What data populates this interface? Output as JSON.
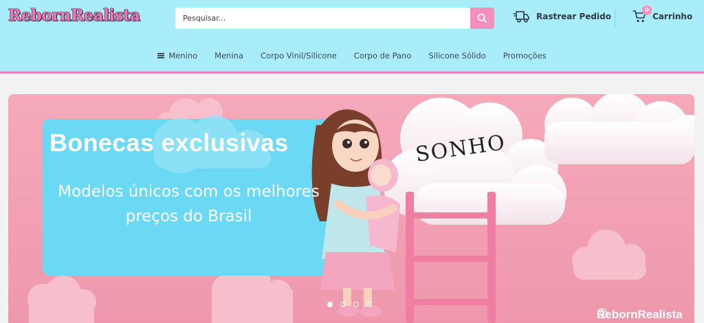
{
  "brand": {
    "logo_text": "RebornRealista"
  },
  "search": {
    "placeholder": "Pesquisar..."
  },
  "header": {
    "track_order_label": "Rastrear Pedido",
    "cart_label": "Carrinho",
    "cart_count": "0"
  },
  "nav": {
    "items": [
      {
        "label": "Menino"
      },
      {
        "label": "Menina"
      },
      {
        "label": "Corpo Vinil/Silicone"
      },
      {
        "label": "Corpo de Pano"
      },
      {
        "label": "Silicone Sólido"
      },
      {
        "label": "Promoções"
      }
    ]
  },
  "hero": {
    "headline": "Bonecas exclusivas",
    "subhead": "Modelos únicos com os melhores preços do Brasil",
    "cloud_text": "SONHO",
    "watermark": "RebornRealista",
    "slides": {
      "count": 4,
      "active": 1
    }
  },
  "colors": {
    "header_bg": "#a9ecfa",
    "accent_pink": "#f48ebd",
    "banner_pink": "#f1a3b4",
    "headline_panel": "#6cd9f4"
  },
  "icons": {
    "search": "search-icon",
    "track": "delivery-truck-icon",
    "cart": "shopping-cart-icon",
    "menu": "hamburger-menu-icon"
  }
}
